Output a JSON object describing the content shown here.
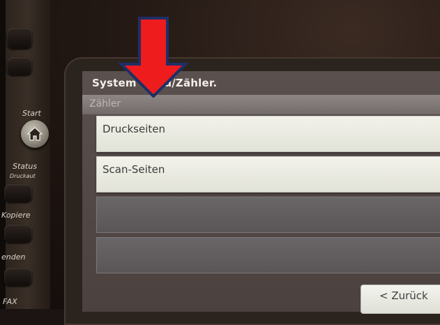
{
  "device_labels": {
    "start": "Start",
    "status": "Status",
    "status_sub": "Druckaut",
    "copy": "Kopiere",
    "send": "enden",
    "fax": "FAX"
  },
  "screen": {
    "title": "System         nü/Zähler.",
    "section": "Zähler",
    "items": [
      {
        "label": "Druckseiten"
      },
      {
        "label": "Scan-Seiten"
      },
      {
        "label": ""
      },
      {
        "label": ""
      }
    ],
    "back_label": "< Zurück"
  },
  "annotation": {
    "arrow_color": "#ee1c1c",
    "arrow_outline": "#1f2f66",
    "icon": "down-arrow-annotation"
  },
  "icons": {
    "home": "home-icon"
  }
}
